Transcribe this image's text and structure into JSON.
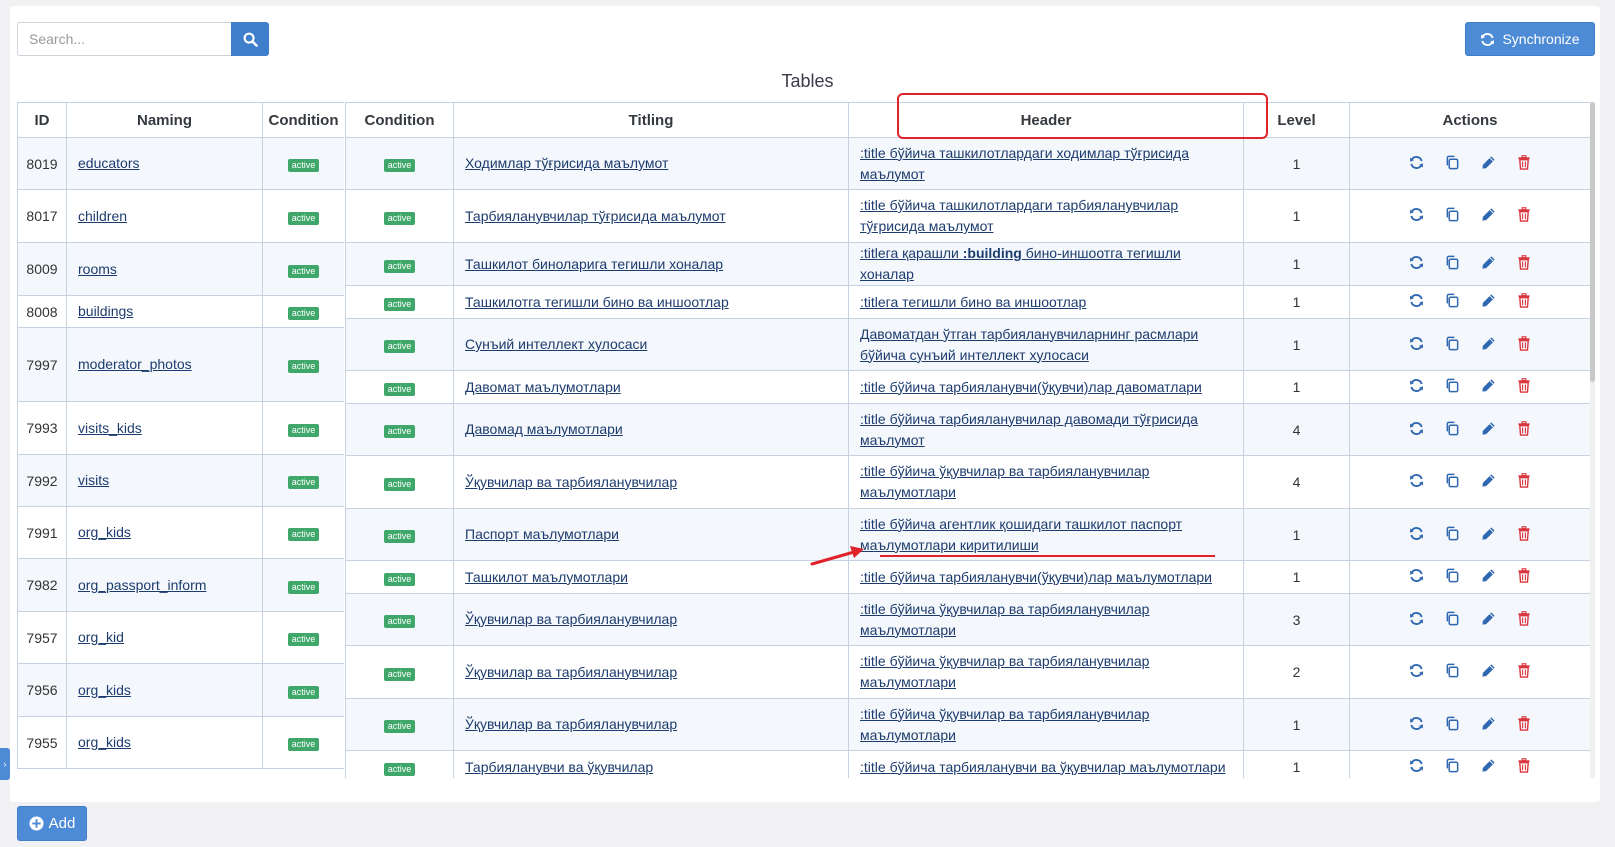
{
  "search": {
    "placeholder": "Search..."
  },
  "toolbar": {
    "sync_label": "Synchronize",
    "add_label": "Add"
  },
  "page_title": "Tables",
  "left_table": {
    "headers": [
      "ID",
      "Naming",
      "Condition"
    ],
    "rows": [
      {
        "id": "8019",
        "name": "educators",
        "status": "active"
      },
      {
        "id": "8017",
        "name": "children",
        "status": "active"
      },
      {
        "id": "8009",
        "name": "rooms",
        "status": "active"
      },
      {
        "id": "8008",
        "name": "buildings",
        "status": "active"
      },
      {
        "id": "7997",
        "name": "moderator_photos",
        "status": "active"
      },
      {
        "id": "7993",
        "name": "visits_kids",
        "status": "active"
      },
      {
        "id": "7992",
        "name": "visits",
        "status": "active"
      },
      {
        "id": "7991",
        "name": "org_kids",
        "status": "active"
      },
      {
        "id": "7982",
        "name": "org_passport_inform",
        "status": "active"
      },
      {
        "id": "7957",
        "name": "org_kid",
        "status": "active"
      },
      {
        "id": "7956",
        "name": "org_kids",
        "status": "active"
      },
      {
        "id": "7955",
        "name": "org_kids",
        "status": "active"
      }
    ]
  },
  "right_table": {
    "headers": [
      "Condition",
      "Titling",
      "Header",
      "Level",
      "Actions"
    ],
    "rows": [
      {
        "status": "active",
        "titling": "Ходимлар тўғрисида маълумот",
        "header": ":title бўйича ташкилотлардаги ходимлар тўғрисида маълумот",
        "level": "1"
      },
      {
        "status": "active",
        "titling": "Тарбияланувчилар тўғрисида маълумот",
        "header": ":title бўйича ташкилотлардаги тарбияланувчилар тўғрисида маълумот",
        "level": "1"
      },
      {
        "status": "active",
        "titling": "Ташкилот биноларига тегишли хоналар",
        "header_prefix": ":titleга қарашли ",
        "header_bold": ":building",
        "header_suffix": " бино-иншоотга тегишли хоналар",
        "level": "1"
      },
      {
        "status": "active",
        "titling": "Ташкилотга тегишли бино ва иншоотлар",
        "header": ":titleга тегишли бино ва иншоотлар",
        "level": "1"
      },
      {
        "status": "active",
        "titling": "Сунъий интеллект хулосаси",
        "header": "Давоматдан ўтган тарбияланувчиларнинг расмлари бўйича сунъий интеллект хулосаси",
        "level": "1"
      },
      {
        "status": "active",
        "titling": "Давомат маълумотлари",
        "header": ":title бўйича тарбияланувчи(ўқувчи)лар давоматлари",
        "level": "1"
      },
      {
        "status": "active",
        "titling": "Давомад маълумотлари",
        "header": ":title бўйича тарбияланувчилар давомади тўғрисида маълумот",
        "level": "4"
      },
      {
        "status": "active",
        "titling": "Ўқувчилар ва тарбияланувчилар",
        "header": ":title бўйича ўқувчилар ва тарбияланувчилар маълумотлари",
        "level": "4"
      },
      {
        "status": "active",
        "titling": "Паспорт маълумотлари",
        "header": ":title бўйича агентлик қошидаги ташкилот паспорт маълумотлари киритилиши",
        "level": "1"
      },
      {
        "status": "active",
        "titling": "Ташкилот маълумотлари",
        "header": ":title бўйича тарбияланувчи(ўқувчи)лар маълумотлари",
        "level": "1"
      },
      {
        "status": "active",
        "titling": "Ўқувчилар ва тарбияланувчилар",
        "header": ":title бўйича ўқувчилар ва тарбияланувчилар маълумотлари",
        "level": "3"
      },
      {
        "status": "active",
        "titling": "Ўқувчилар ва тарбияланувчилар",
        "header": ":title бўйича ўқувчилар ва тарбияланувчилар маълумотлари",
        "level": "2"
      },
      {
        "status": "active",
        "titling": "Ўқувчилар ва тарбияланувчилар",
        "header": ":title бўйича ўқувчилар ва тарбияланувчилар маълумотлари",
        "level": "1"
      },
      {
        "status": "active",
        "titling": "Тарбияланувчи ва ўқувчилар",
        "header": ":title бўйича тарбияланувчи ва ўқувчилар маълумотлари",
        "level": "1"
      }
    ]
  },
  "icons": {
    "search": "search-icon",
    "sync": "sync-icon",
    "refresh": "refresh-icon",
    "copy": "copy-icon",
    "edit": "pencil-icon",
    "delete": "trash-icon",
    "add": "plus-circle-icon"
  },
  "colors": {
    "primary": "#4d8bd6",
    "success_badge": "#3fa76a",
    "link": "#1d3c6e",
    "delete": "#d9363e",
    "annotation": "#e0232b"
  }
}
